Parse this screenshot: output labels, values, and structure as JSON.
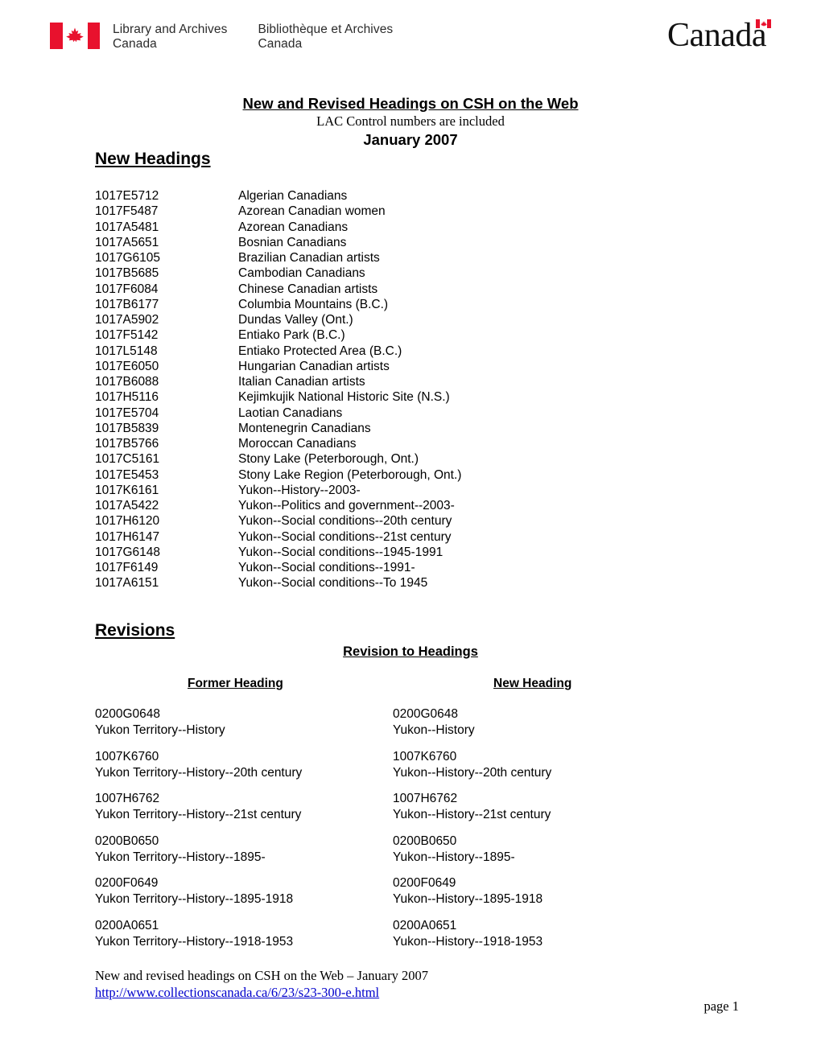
{
  "header": {
    "flag_icon": "canada-flag-icon",
    "org_name_en": "Library and Archives\nCanada",
    "org_name_en_line1": "Library and Archives",
    "org_name_en_line2": "Canada",
    "org_name_fr_line1": "Bibliothèque et Archives",
    "org_name_fr_line2": "Canada",
    "wordmark": "Canada",
    "flag_red": "#e8112d"
  },
  "title_block": {
    "title": "New and Revised Headings on CSH on the Web",
    "subtitle": "LAC Control numbers are included",
    "date": "January 2007"
  },
  "sections": {
    "new_headings_label": "New Headings",
    "revisions_label": "Revisions",
    "revision_to_headings_label": "Revision to Headings"
  },
  "new_headings": [
    {
      "control": "1017E5712",
      "heading": "Algerian Canadians"
    },
    {
      "control": "1017F5487",
      "heading": "Azorean Canadian women"
    },
    {
      "control": "1017A5481",
      "heading": "Azorean Canadians"
    },
    {
      "control": "1017A5651",
      "heading": "Bosnian Canadians"
    },
    {
      "control": "1017G6105",
      "heading": "Brazilian Canadian artists"
    },
    {
      "control": "1017B5685",
      "heading": "Cambodian Canadians"
    },
    {
      "control": "1017F6084",
      "heading": "Chinese Canadian artists"
    },
    {
      "control": "1017B6177",
      "heading": "Columbia Mountains (B.C.)"
    },
    {
      "control": "1017A5902",
      "heading": "Dundas Valley (Ont.)"
    },
    {
      "control": "1017F5142",
      "heading": "Entiako Park (B.C.)"
    },
    {
      "control": "1017L5148",
      "heading": "Entiako Protected Area (B.C.)"
    },
    {
      "control": "1017E6050",
      "heading": "Hungarian Canadian artists"
    },
    {
      "control": "1017B6088",
      "heading": "Italian Canadian artists"
    },
    {
      "control": "1017H5116",
      "heading": "Kejimkujik National Historic Site (N.S.)"
    },
    {
      "control": "1017E5704",
      "heading": "Laotian Canadians"
    },
    {
      "control": "1017B5839",
      "heading": "Montenegrin Canadians"
    },
    {
      "control": "1017B5766",
      "heading": "Moroccan Canadians"
    },
    {
      "control": "1017C5161",
      "heading": "Stony Lake (Peterborough, Ont.)"
    },
    {
      "control": "1017E5453",
      "heading": "Stony Lake Region (Peterborough, Ont.)"
    },
    {
      "control": "1017K6161",
      "heading": "Yukon--History--2003-"
    },
    {
      "control": "1017A5422",
      "heading": "Yukon--Politics and government--2003-"
    },
    {
      "control": "1017H6120",
      "heading": "Yukon--Social conditions--20th century"
    },
    {
      "control": "1017H6147",
      "heading": "Yukon--Social conditions--21st century"
    },
    {
      "control": "1017G6148",
      "heading": "Yukon--Social conditions--1945-1991"
    },
    {
      "control": "1017F6149",
      "heading": "Yukon--Social conditions--1991-"
    },
    {
      "control": "1017A6151",
      "heading": "Yukon--Social conditions--To 1945"
    }
  ],
  "revisions": {
    "col_former_label": "Former Heading",
    "col_new_label": "New Heading",
    "rows": [
      {
        "former_control": "0200G0648",
        "former_heading": "Yukon Territory--History",
        "new_control": "0200G0648",
        "new_heading": "Yukon--History"
      },
      {
        "former_control": "1007K6760",
        "former_heading": "Yukon Territory--History--20th century",
        "new_control": "1007K6760",
        "new_heading": "Yukon--History--20th century"
      },
      {
        "former_control": "1007H6762",
        "former_heading": "Yukon Territory--History--21st century",
        "new_control": "1007H6762",
        "new_heading": "Yukon--History--21st century"
      },
      {
        "former_control": "0200B0650",
        "former_heading": "Yukon Territory--History--1895-",
        "new_control": "0200B0650",
        "new_heading": "Yukon--History--1895-"
      },
      {
        "former_control": "0200F0649",
        "former_heading": "Yukon Territory--History--1895-1918",
        "new_control": "0200F0649",
        "new_heading": "Yukon--History--1895-1918"
      },
      {
        "former_control": "0200A0651",
        "former_heading": "Yukon Territory--History--1918-1953",
        "new_control": "0200A0651",
        "new_heading": "Yukon--History--1918-1953"
      }
    ]
  },
  "footer": {
    "line1": "New and revised headings on CSH on the Web – January 2007",
    "url": "http://www.collectionscanada.ca/6/23/s23-300-e.html",
    "url_color": "#0000cc",
    "page": "page 1"
  }
}
